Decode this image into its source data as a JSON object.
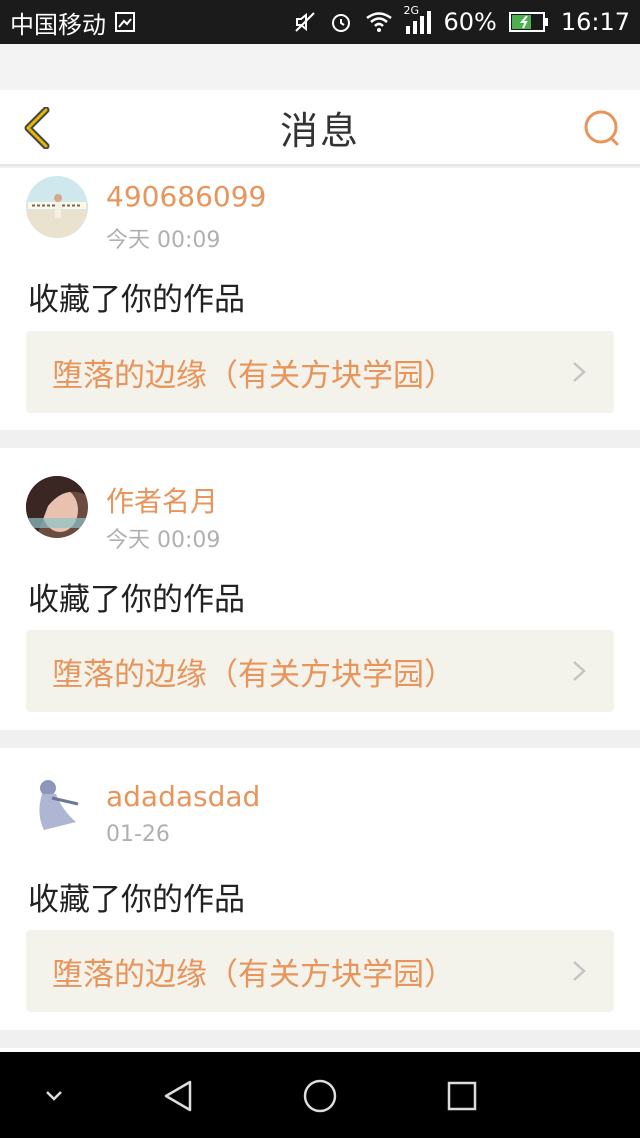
{
  "status_bar": {
    "carrier": "中国移动",
    "network": "2G",
    "battery": "60%",
    "time": "16:17"
  },
  "header": {
    "title": "消息",
    "back_icon": "chevron-left-icon",
    "search_icon": "search-icon"
  },
  "messages": [
    {
      "username": "490686099",
      "time": "今天 00:09",
      "action": "收藏了你的作品",
      "work_title": "堕落的边缘（有关方块学园）"
    },
    {
      "username": "作者名月",
      "time": "今天 00:09",
      "action": "收藏了你的作品",
      "work_title": "堕落的边缘（有关方块学园）"
    },
    {
      "username": "adadasdad",
      "time": "01-26",
      "action": "收藏了你的作品",
      "work_title": "堕落的边缘（有关方块学园）"
    }
  ],
  "colors": {
    "accent": "#e8945a",
    "back_icon": "#e6b800",
    "link_bg": "#f3f3ec"
  }
}
